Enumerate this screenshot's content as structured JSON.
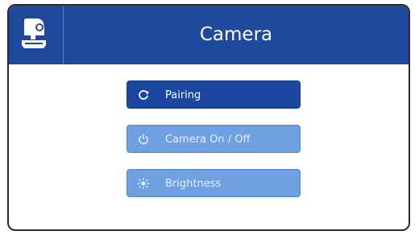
{
  "header": {
    "title": "Camera",
    "icon": "camera-device-icon",
    "color": "#1f4a9c"
  },
  "menu": {
    "items": [
      {
        "label": "Pairing",
        "icon": "pairing-icon",
        "state": "active",
        "color": "#1b47a3"
      },
      {
        "label": "Camera On / Off",
        "icon": "power-icon",
        "state": "inactive",
        "color": "#6ea0e2"
      },
      {
        "label": "Brightness",
        "icon": "brightness-icon",
        "state": "inactive",
        "color": "#6ea0e2"
      }
    ]
  }
}
